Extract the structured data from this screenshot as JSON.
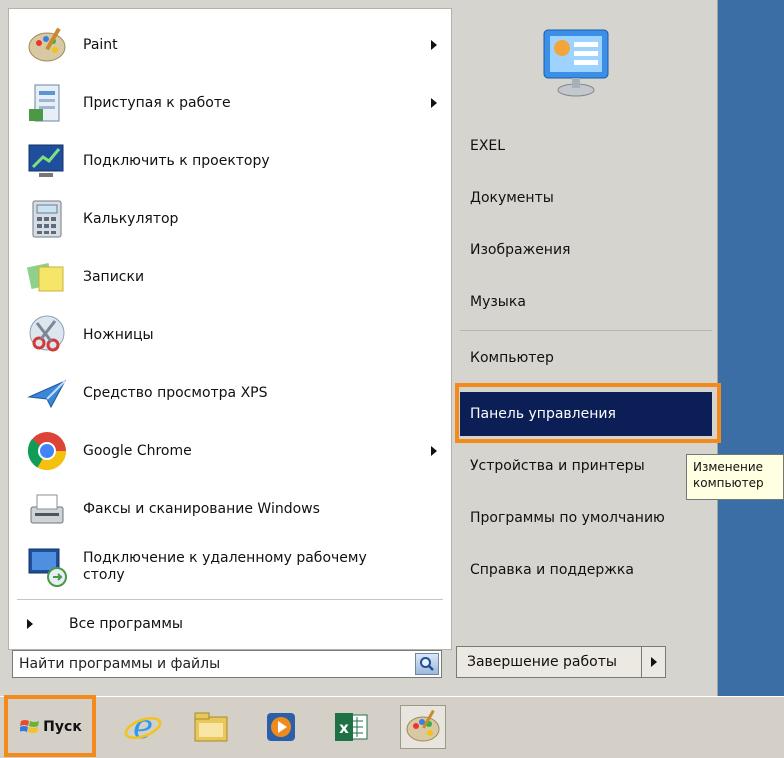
{
  "programs": [
    {
      "label": "Paint",
      "has_submenu": true
    },
    {
      "label": "Приступая к работе",
      "has_submenu": true
    },
    {
      "label": "Подключить к проектору",
      "has_submenu": false
    },
    {
      "label": "Калькулятор",
      "has_submenu": false
    },
    {
      "label": "Записки",
      "has_submenu": false
    },
    {
      "label": "Ножницы",
      "has_submenu": false
    },
    {
      "label": "Средство просмотра XPS",
      "has_submenu": false
    },
    {
      "label": "Google Chrome",
      "has_submenu": true
    },
    {
      "label": "Факсы и сканирование Windows",
      "has_submenu": false
    },
    {
      "label": "Подключение к удаленному рабочему столу",
      "has_submenu": false
    }
  ],
  "all_programs_label": "Все программы",
  "search": {
    "placeholder": "Найти программы и файлы"
  },
  "right_links": {
    "exel": "EXEL",
    "documents": "Документы",
    "images": "Изображения",
    "music": "Музыка",
    "computer": "Компьютер",
    "control_panel": "Панель управления",
    "devices": "Устройства и принтеры",
    "defaults": "Программы по умолчанию",
    "help": "Справка и поддержка"
  },
  "shutdown_label": "Завершение работы",
  "tooltip": {
    "line1": "Изменение",
    "line2": "компьютер"
  },
  "taskbar": {
    "start_label": "Пуск",
    "icons": [
      "internet-explorer-icon",
      "file-manager-icon",
      "media-player-icon",
      "excel-icon",
      "paint-icon"
    ]
  },
  "colors": {
    "highlight": "#f28a1c",
    "active_item": "#0b1e55",
    "desktop": "#3b6ea5"
  }
}
